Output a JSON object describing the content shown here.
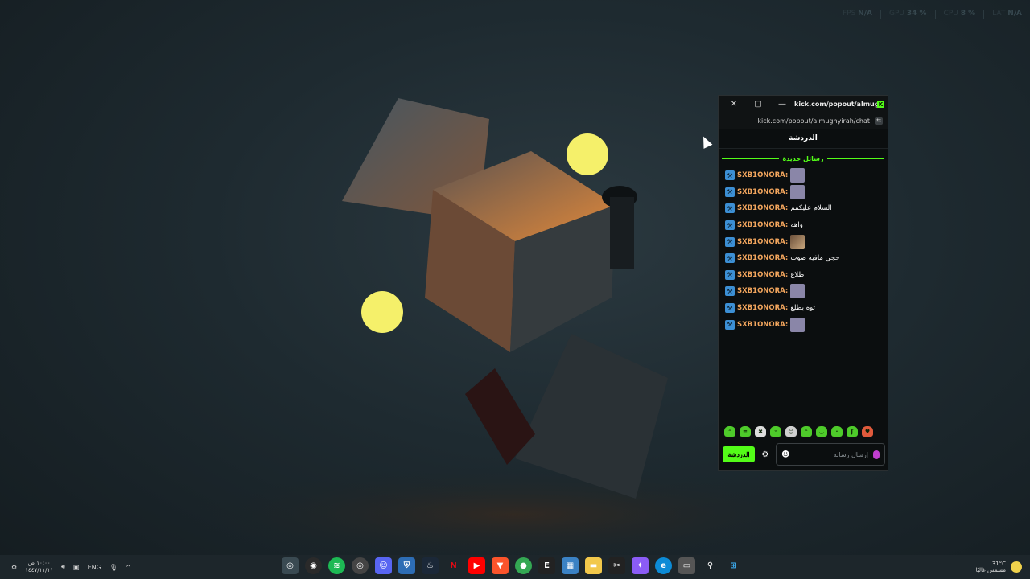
{
  "stats": {
    "fps_label": "FPS",
    "fps_value": "N/A",
    "gpu_label": "GPU",
    "gpu_value": "34 %",
    "cpu_label": "CPU",
    "cpu_value": "8 %",
    "lat_label": "LAT",
    "lat_value": "N/A"
  },
  "window": {
    "title": "kick.com/popout/almughyir...",
    "close_icon": "✕",
    "maximize_icon": "▢",
    "minimize_icon": "—",
    "url": "kick.com/popout/almughyirah/chat"
  },
  "chat": {
    "header": "الدردشة",
    "new_messages": "رسائل جديدة",
    "messages": [
      {
        "user": "SXB1ONORA:",
        "text": "",
        "emote": "purple"
      },
      {
        "user": "SXB1ONORA:",
        "text": "",
        "emote": "purple"
      },
      {
        "user": "SXB1ONORA:",
        "text": "السلام عليكمم",
        "emote": ""
      },
      {
        "user": "SXB1ONORA:",
        "text": "واهه",
        "emote": ""
      },
      {
        "user": "SXB1ONORA:",
        "text": "",
        "emote": "photo"
      },
      {
        "user": "SXB1ONORA:",
        "text": "حجي مافيه صوت",
        "emote": ""
      },
      {
        "user": "SXB1ONORA:",
        "text": "طلاع",
        "emote": ""
      },
      {
        "user": "SXB1ONORA:",
        "text": "",
        "emote": "purple"
      },
      {
        "user": "SXB1ONORA:",
        "text": "توه يطلع",
        "emote": ""
      },
      {
        "user": "SXB1ONORA:",
        "text": "",
        "emote": "purple"
      }
    ],
    "send_button": "الدردشة",
    "input_placeholder": "إرسال رسالة",
    "gear_icon": "⚙",
    "emoji_icon": "☻"
  },
  "taskbar": {
    "clock_time": "١٠:٠٠ ص",
    "clock_date": "١٤٤٧/١١/١١",
    "language": "ENG",
    "weather_temp": "31°C",
    "weather_desc": "مشمس غالبًا"
  },
  "colors": {
    "accent": "#53fc18",
    "username": "#f2a55d",
    "badge": "#3c8fd4"
  }
}
